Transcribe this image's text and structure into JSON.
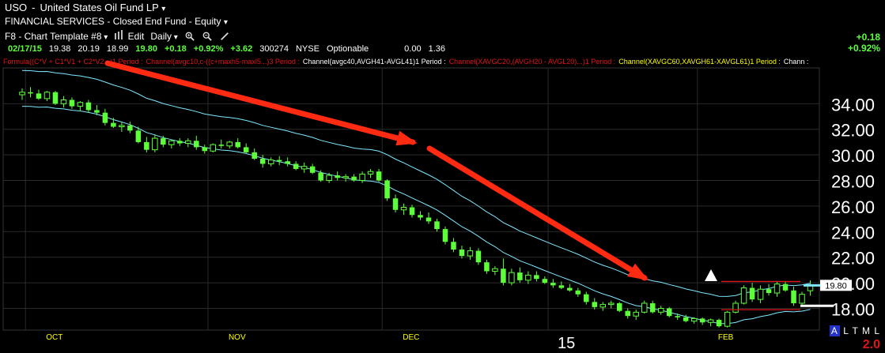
{
  "header": {
    "symbol": "USO",
    "name": "United States Oil Fund LP",
    "sector": "FINANCIAL SERVICES",
    "type": "Closed End Fund",
    "class": "Equity",
    "template": "F8 - Chart Template #8",
    "edit_label": "Edit",
    "interval": "Daily"
  },
  "quote": {
    "date": "02/17/15",
    "open": "19.38",
    "high": "20.19",
    "low": "18.99",
    "last": "19.80",
    "change": "+0.18",
    "pct": "+0.92%",
    "change2": "+3.62",
    "volume": "300274",
    "exchange": "NYSE",
    "options": "Optionable",
    "bid": "0.00",
    "ask": "1.36"
  },
  "right_change": {
    "change": "+0.18",
    "pct": "+0.92%"
  },
  "studies": [
    {
      "text": "Formula((C*V + C1*V1 + C2*V2...)1 Period",
      "color": "#e0141a"
    },
    {
      "text": "Channel(avgc10,c-((c+maxh5-maxl5...)3 Period",
      "color": "#e0141a"
    },
    {
      "text": "Channel(avgc40,AVGH41-AVGL41)1 Period",
      "color": "#ffffff"
    },
    {
      "text": "Channel(XAVGC20,(AVGH20 - AVGL20)...)1 Period",
      "color": "#e0141a"
    },
    {
      "text": "Channel(XAVGC60,XAVGH61-XAVGL61)1 Period",
      "color": "#ffff00"
    },
    {
      "text": "Chann",
      "color": "#ffffff"
    }
  ],
  "colors": {
    "candle": "#5dff3a",
    "channel": "#7fe8ff",
    "arrow": "#ff2a12",
    "resistance": "#e0141a",
    "grid": "#2a2a2a"
  },
  "controls": {
    "alt": "A",
    "rest": "L T M L",
    "zoom": "2.0"
  },
  "chart_data": {
    "type": "candlestick",
    "symbol": "USO",
    "y_ticks": [
      "34.00",
      "32.00",
      "30.00",
      "28.00",
      "26.00",
      "24.00",
      "22.00",
      "20.00",
      "18.00"
    ],
    "ylim": [
      16.3,
      36.8
    ],
    "x_labels": [
      {
        "label": "OCT",
        "idx": 1
      },
      {
        "label": "NOV",
        "idx": 23
      },
      {
        "label": "DEC",
        "idx": 44
      },
      {
        "label": "15",
        "idx": 64
      },
      {
        "label": "FEB",
        "idx": 82
      }
    ],
    "last_price_label": "19.80",
    "candles": [
      [
        34.7,
        35.2,
        34.3,
        34.9
      ],
      [
        34.9,
        35.3,
        34.5,
        34.8
      ],
      [
        34.8,
        35.1,
        34.3,
        34.4
      ],
      [
        34.4,
        35.0,
        34.2,
        34.9
      ],
      [
        34.9,
        35.0,
        33.9,
        34.0
      ],
      [
        34.0,
        34.6,
        33.7,
        34.3
      ],
      [
        34.3,
        34.5,
        33.6,
        33.8
      ],
      [
        33.8,
        34.2,
        33.4,
        34.1
      ],
      [
        34.1,
        34.3,
        33.3,
        33.5
      ],
      [
        33.5,
        33.9,
        33.1,
        33.3
      ],
      [
        33.3,
        33.6,
        32.3,
        32.5
      ],
      [
        32.5,
        32.9,
        32.1,
        32.2
      ],
      [
        32.2,
        32.6,
        31.8,
        32.3
      ],
      [
        32.3,
        32.6,
        31.7,
        31.9
      ],
      [
        31.9,
        32.2,
        30.9,
        31.0
      ],
      [
        31.0,
        31.4,
        30.2,
        30.4
      ],
      [
        30.4,
        31.6,
        30.2,
        31.3
      ],
      [
        31.3,
        31.5,
        30.6,
        30.8
      ],
      [
        30.8,
        31.2,
        30.5,
        31.1
      ],
      [
        31.1,
        31.3,
        30.7,
        30.9
      ],
      [
        30.9,
        31.3,
        30.6,
        31.1
      ],
      [
        31.1,
        31.5,
        30.4,
        30.6
      ],
      [
        30.6,
        30.8,
        30.1,
        30.3
      ],
      [
        30.3,
        30.9,
        30.2,
        30.8
      ],
      [
        30.8,
        31.2,
        30.5,
        30.7
      ],
      [
        30.7,
        31.1,
        30.5,
        31.0
      ],
      [
        31.0,
        31.3,
        30.5,
        30.6
      ],
      [
        30.6,
        30.9,
        30.1,
        30.2
      ],
      [
        30.2,
        30.5,
        29.6,
        29.7
      ],
      [
        29.7,
        30.0,
        29.0,
        29.3
      ],
      [
        29.3,
        29.8,
        29.1,
        29.6
      ],
      [
        29.6,
        29.9,
        29.2,
        29.5
      ],
      [
        29.5,
        29.8,
        29.1,
        29.3
      ],
      [
        29.3,
        29.5,
        28.8,
        28.9
      ],
      [
        28.9,
        29.4,
        28.6,
        29.1
      ],
      [
        29.1,
        29.3,
        28.5,
        28.6
      ],
      [
        28.6,
        28.8,
        27.9,
        28.0
      ],
      [
        28.0,
        28.6,
        27.8,
        28.4
      ],
      [
        28.4,
        28.7,
        28.0,
        28.2
      ],
      [
        28.2,
        28.5,
        27.9,
        28.3
      ],
      [
        28.3,
        28.5,
        27.9,
        28.0
      ],
      [
        28.0,
        28.7,
        27.8,
        28.5
      ],
      [
        28.5,
        28.9,
        28.2,
        28.7
      ],
      [
        28.7,
        28.9,
        27.9,
        28.0
      ],
      [
        28.0,
        28.1,
        26.4,
        26.6
      ],
      [
        26.6,
        26.9,
        25.5,
        25.7
      ],
      [
        25.7,
        26.2,
        25.3,
        25.9
      ],
      [
        25.9,
        26.1,
        25.1,
        25.3
      ],
      [
        25.3,
        25.6,
        24.9,
        25.1
      ],
      [
        25.1,
        25.5,
        24.6,
        24.8
      ],
      [
        24.8,
        25.0,
        24.0,
        24.2
      ],
      [
        24.2,
        24.4,
        23.0,
        23.2
      ],
      [
        23.2,
        23.5,
        22.4,
        22.6
      ],
      [
        22.6,
        22.9,
        21.9,
        22.1
      ],
      [
        22.1,
        22.8,
        21.8,
        22.5
      ],
      [
        22.5,
        22.7,
        21.4,
        21.6
      ],
      [
        21.6,
        21.8,
        20.7,
        20.9
      ],
      [
        20.9,
        21.3,
        20.6,
        21.1
      ],
      [
        21.1,
        21.9,
        19.8,
        20.0
      ],
      [
        20.0,
        21.1,
        19.8,
        20.8
      ],
      [
        20.8,
        21.2,
        20.0,
        20.2
      ],
      [
        20.2,
        20.9,
        19.9,
        20.6
      ],
      [
        20.6,
        20.9,
        20.1,
        20.3
      ],
      [
        20.3,
        20.5,
        19.9,
        20.0
      ],
      [
        20.0,
        20.3,
        19.6,
        19.8
      ],
      [
        19.8,
        20.1,
        19.5,
        19.6
      ],
      [
        19.6,
        19.9,
        19.3,
        19.4
      ],
      [
        19.4,
        19.6,
        18.9,
        19.1
      ],
      [
        19.1,
        19.3,
        18.3,
        18.5
      ],
      [
        18.5,
        18.8,
        17.9,
        18.1
      ],
      [
        18.1,
        18.5,
        17.8,
        18.3
      ],
      [
        18.3,
        18.6,
        18.0,
        18.4
      ],
      [
        18.4,
        18.5,
        17.7,
        17.8
      ],
      [
        17.8,
        18.0,
        17.2,
        17.4
      ],
      [
        17.4,
        17.9,
        17.1,
        17.7
      ],
      [
        17.7,
        18.6,
        17.6,
        18.4
      ],
      [
        18.4,
        18.6,
        17.6,
        17.7
      ],
      [
        17.7,
        18.2,
        17.5,
        18.0
      ],
      [
        18.0,
        18.1,
        17.3,
        17.4
      ],
      [
        17.4,
        17.6,
        17.1,
        17.3
      ],
      [
        17.3,
        17.5,
        16.9,
        17.0
      ],
      [
        17.0,
        17.3,
        16.8,
        17.2
      ],
      [
        17.2,
        17.3,
        16.7,
        16.9
      ],
      [
        16.9,
        17.2,
        16.6,
        17.1
      ],
      [
        17.1,
        17.2,
        16.5,
        16.6
      ],
      [
        16.6,
        17.8,
        16.5,
        17.7
      ],
      [
        17.7,
        18.6,
        17.6,
        18.4
      ],
      [
        18.4,
        19.8,
        18.3,
        19.6
      ],
      [
        19.6,
        20.0,
        18.5,
        18.7
      ],
      [
        18.7,
        19.8,
        18.4,
        19.5
      ],
      [
        19.5,
        19.9,
        19.0,
        19.2
      ],
      [
        19.2,
        20.1,
        18.9,
        19.9
      ],
      [
        19.9,
        20.1,
        19.3,
        19.4
      ],
      [
        19.4,
        19.7,
        18.2,
        18.4
      ],
      [
        18.4,
        19.3,
        18.3,
        19.1
      ],
      [
        19.38,
        20.19,
        18.99,
        19.8
      ]
    ]
  }
}
